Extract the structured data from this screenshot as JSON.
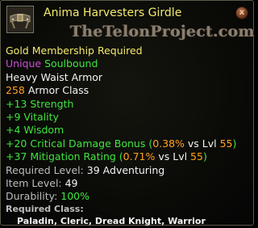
{
  "item": {
    "name": "Anima Harvesters Girdle",
    "watermark": "TheTelonProject.com",
    "close_symbol": "x",
    "icon": "belt-icon",
    "membership": "Gold Membership Required",
    "flags": {
      "unique": "Unique",
      "soulbound": "Soulbound"
    },
    "type": "Heavy Waist Armor",
    "armor": {
      "value": "258",
      "label": "Armor Class"
    },
    "stats": [
      "+13 Strength",
      "+9 Vitality",
      "+4 Wisdom"
    ],
    "crit": {
      "prefix": "+20 Critical Damage Bonus (",
      "pct": "0.38%",
      "vs": " vs Lvl ",
      "lvl": "55",
      "suffix": ")"
    },
    "mitig": {
      "prefix": "+37 Mitigation Rating (",
      "pct": "0.71%",
      "vs": " vs Lvl ",
      "lvl": "55",
      "suffix": ")"
    },
    "required_level": {
      "label": "Required Level: ",
      "value": "39 Adventuring"
    },
    "item_level": {
      "label": "Item Level: ",
      "value": "49"
    },
    "durability": {
      "label": "Durability: ",
      "value": "100%"
    },
    "required_class": {
      "label": "Required Class:",
      "value": "Paladin, Cleric, Dread Knight, Warrior"
    },
    "colors": {
      "title": "#f3ea6c",
      "stat": "#3fe43f",
      "unique": "#c94fd6",
      "level": "#ffa11e"
    }
  }
}
